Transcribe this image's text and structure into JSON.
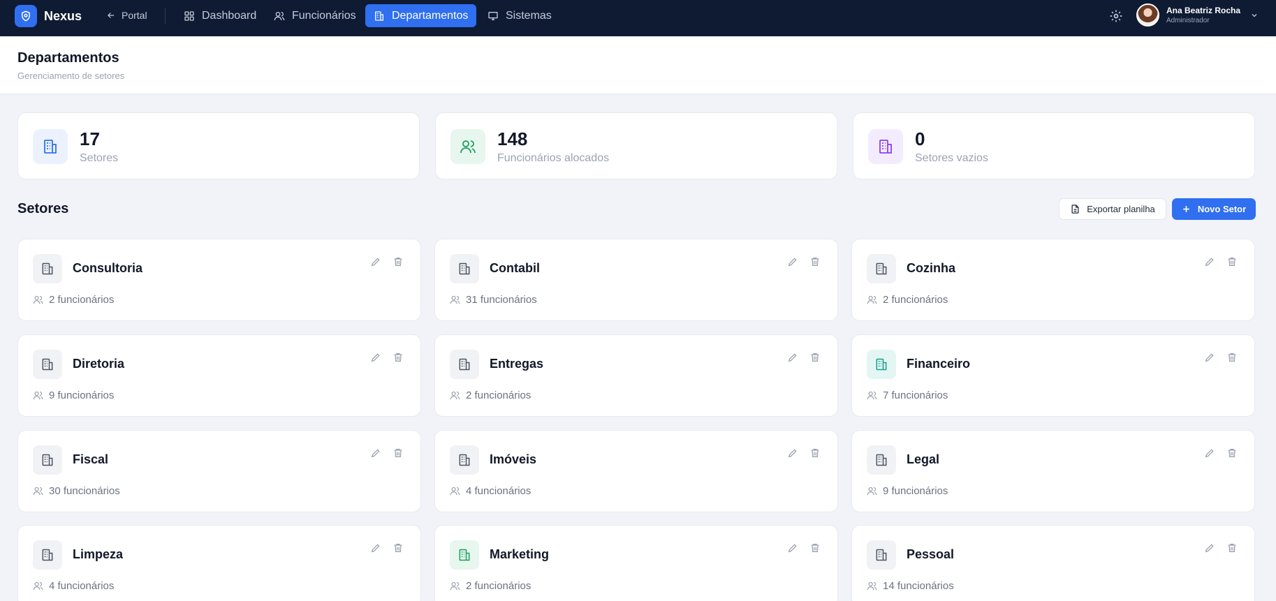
{
  "nav": {
    "brand": "Nexus",
    "portal_label": "Portal",
    "items": [
      {
        "label": "Dashboard",
        "icon": "grid-icon"
      },
      {
        "label": "Funcionários",
        "icon": "user-icon"
      },
      {
        "label": "Departamentos",
        "icon": "building-icon",
        "active": true
      },
      {
        "label": "Sistemas",
        "icon": "monitor-icon"
      }
    ],
    "user": {
      "name": "Ana Beatriz Rocha",
      "role": "Administrador"
    }
  },
  "header": {
    "title": "Departamentos",
    "subtitle": "Gerenciamento de setores"
  },
  "stats": [
    {
      "value": "17",
      "label": "Setores",
      "icon": "building-icon",
      "color": "#2f6ff0",
      "bg": "#ebf2fe"
    },
    {
      "value": "148",
      "label": "Funcionários alocados",
      "icon": "users-icon",
      "color": "#18a05a",
      "bg": "#e7f6ee"
    },
    {
      "value": "0",
      "label": "Setores vazios",
      "icon": "building-icon",
      "color": "#8b3ff0",
      "bg": "#f3ecfe"
    }
  ],
  "section": {
    "title": "Setores",
    "export_label": "Exportar planilha",
    "new_label": "Novo Setor"
  },
  "sectors": [
    {
      "name": "Consultoria",
      "count": "2 funcionários",
      "tone": "gray"
    },
    {
      "name": "Contabil",
      "count": "31 funcionários",
      "tone": "gray"
    },
    {
      "name": "Cozinha",
      "count": "2 funcionários",
      "tone": "gray"
    },
    {
      "name": "Diretoria",
      "count": "9 funcionários",
      "tone": "gray"
    },
    {
      "name": "Entregas",
      "count": "2 funcionários",
      "tone": "gray"
    },
    {
      "name": "Financeiro",
      "count": "7 funcionários",
      "tone": "teal"
    },
    {
      "name": "Fiscal",
      "count": "30 funcionários",
      "tone": "gray"
    },
    {
      "name": "Imóveis",
      "count": "4 funcionários",
      "tone": "gray"
    },
    {
      "name": "Legal",
      "count": "9 funcionários",
      "tone": "gray"
    },
    {
      "name": "Limpeza",
      "count": "4 funcionários",
      "tone": "gray"
    },
    {
      "name": "Marketing",
      "count": "2 funcionários",
      "tone": "green"
    },
    {
      "name": "Pessoal",
      "count": "14 funcionários",
      "tone": "gray"
    }
  ],
  "colors": {
    "accent": "#2f6ff0",
    "nav_bg": "#0f1b33",
    "page_bg": "#f1f3f8"
  }
}
